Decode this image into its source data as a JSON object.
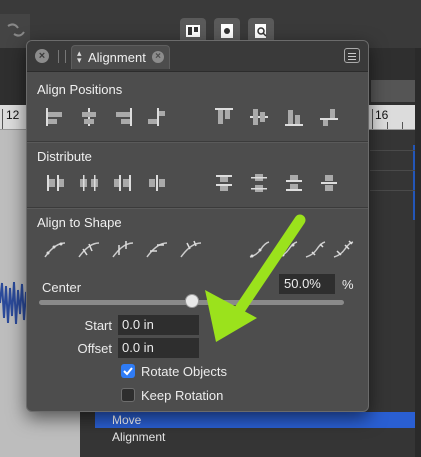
{
  "background": {
    "ruler_labels": [
      "12",
      "16"
    ],
    "list_items": [
      {
        "label": "Move",
        "selected": true
      },
      {
        "label": "Alignment",
        "selected": false
      }
    ],
    "toolbar_icons": [
      "track-icon",
      "cog-doc-icon",
      "inspect-doc-icon"
    ]
  },
  "panel": {
    "tab_label": "Alignment",
    "sections": {
      "align_positions": "Align Positions",
      "distribute": "Distribute",
      "align_to_shape": "Align to Shape"
    },
    "center": {
      "label": "Center",
      "value": "50.0%",
      "unit": "%",
      "slider_fraction": 0.5
    },
    "start": {
      "label": "Start",
      "value": "0.0 in"
    },
    "offset": {
      "label": "Offset",
      "value": "0.0 in"
    },
    "rotate_objects": {
      "label": "Rotate Objects",
      "checked": true
    },
    "keep_rotation": {
      "label": "Keep Rotation",
      "checked": false
    }
  },
  "colors": {
    "accent_blue": "#2f7cf6",
    "arrow_green": "#9be21c",
    "panel_bg": "#4d4d4d"
  }
}
